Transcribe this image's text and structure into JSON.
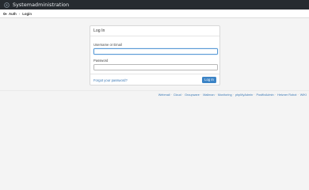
{
  "app": {
    "title": "Systemadministration"
  },
  "breadcrumb": {
    "items": [
      {
        "label": "Auth",
        "icon": "key-icon"
      },
      {
        "label": "Login"
      }
    ],
    "separator": "›"
  },
  "login_card": {
    "title": "Log In",
    "username_label": "Username or Email",
    "username_value": "",
    "password_label": "Password",
    "password_value": "",
    "forgot_link": "Forgot your password?",
    "submit_label": "Log In"
  },
  "footer": {
    "links": [
      "Webmail",
      "Cloud",
      "Groupware",
      "Mailman",
      "Monitoring",
      "phpMyAdmin",
      "PostfixAdmin",
      "Hetzner Robot",
      "WIKI"
    ],
    "separator": "·"
  },
  "colors": {
    "topbar": "#262b30",
    "accent": "#3c84c6",
    "link": "#3a78b5"
  }
}
